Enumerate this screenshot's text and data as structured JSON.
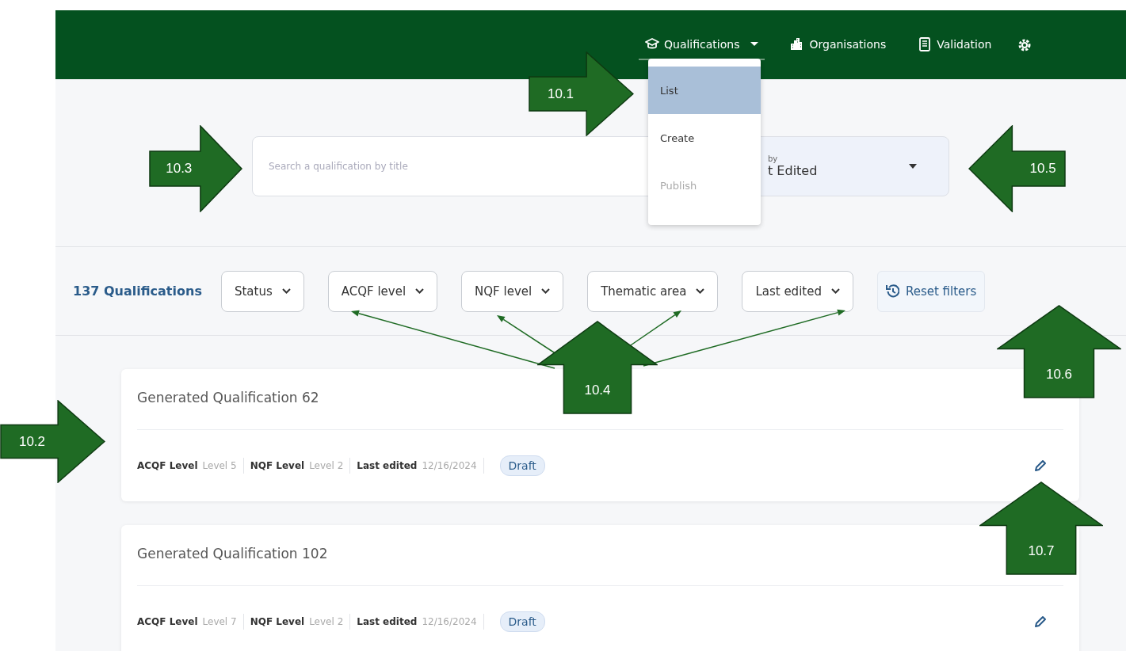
{
  "nav": {
    "items": [
      {
        "label": "Qualifications",
        "selected": true,
        "has_menu": true
      },
      {
        "label": "Organisations",
        "selected": false,
        "has_menu": false
      },
      {
        "label": "Validation",
        "selected": false,
        "has_menu": false
      }
    ]
  },
  "menu": {
    "items": [
      {
        "label": "List",
        "selected": true,
        "disabled": false
      },
      {
        "label": "Create",
        "selected": false,
        "disabled": false
      },
      {
        "label": "Publish",
        "selected": false,
        "disabled": true
      }
    ]
  },
  "search": {
    "placeholder": "Search a qualification by title"
  },
  "sort": {
    "label": "by",
    "value": "t Edited"
  },
  "count": "137 Qualifications",
  "filters": [
    "Status",
    "ACQF level",
    "NQF level",
    "Thematic area",
    "Last edited"
  ],
  "reset": "Reset filters",
  "cards": [
    {
      "title": "Generated Qualification 62",
      "fields": [
        {
          "label": "ACQF Level",
          "value": "Level 5"
        },
        {
          "label": "NQF Level",
          "value": "Level 2"
        },
        {
          "label": "Last edited",
          "value": "12/16/2024"
        }
      ],
      "status": "Draft"
    },
    {
      "title": "Generated Qualification 102",
      "fields": [
        {
          "label": "ACQF Level",
          "value": "Level 7"
        },
        {
          "label": "NQF Level",
          "value": "Level 2"
        },
        {
          "label": "Last edited",
          "value": "12/16/2024"
        }
      ],
      "status": "Draft"
    }
  ],
  "annotations": [
    {
      "label": "10.1",
      "kind": "right"
    },
    {
      "label": "10.3",
      "kind": "right"
    },
    {
      "label": "10.5",
      "kind": "left"
    },
    {
      "label": "10.4",
      "kind": "up"
    },
    {
      "label": "10.6",
      "kind": "up"
    },
    {
      "label": "10.2",
      "kind": "right"
    },
    {
      "label": "10.7",
      "kind": "up"
    }
  ]
}
